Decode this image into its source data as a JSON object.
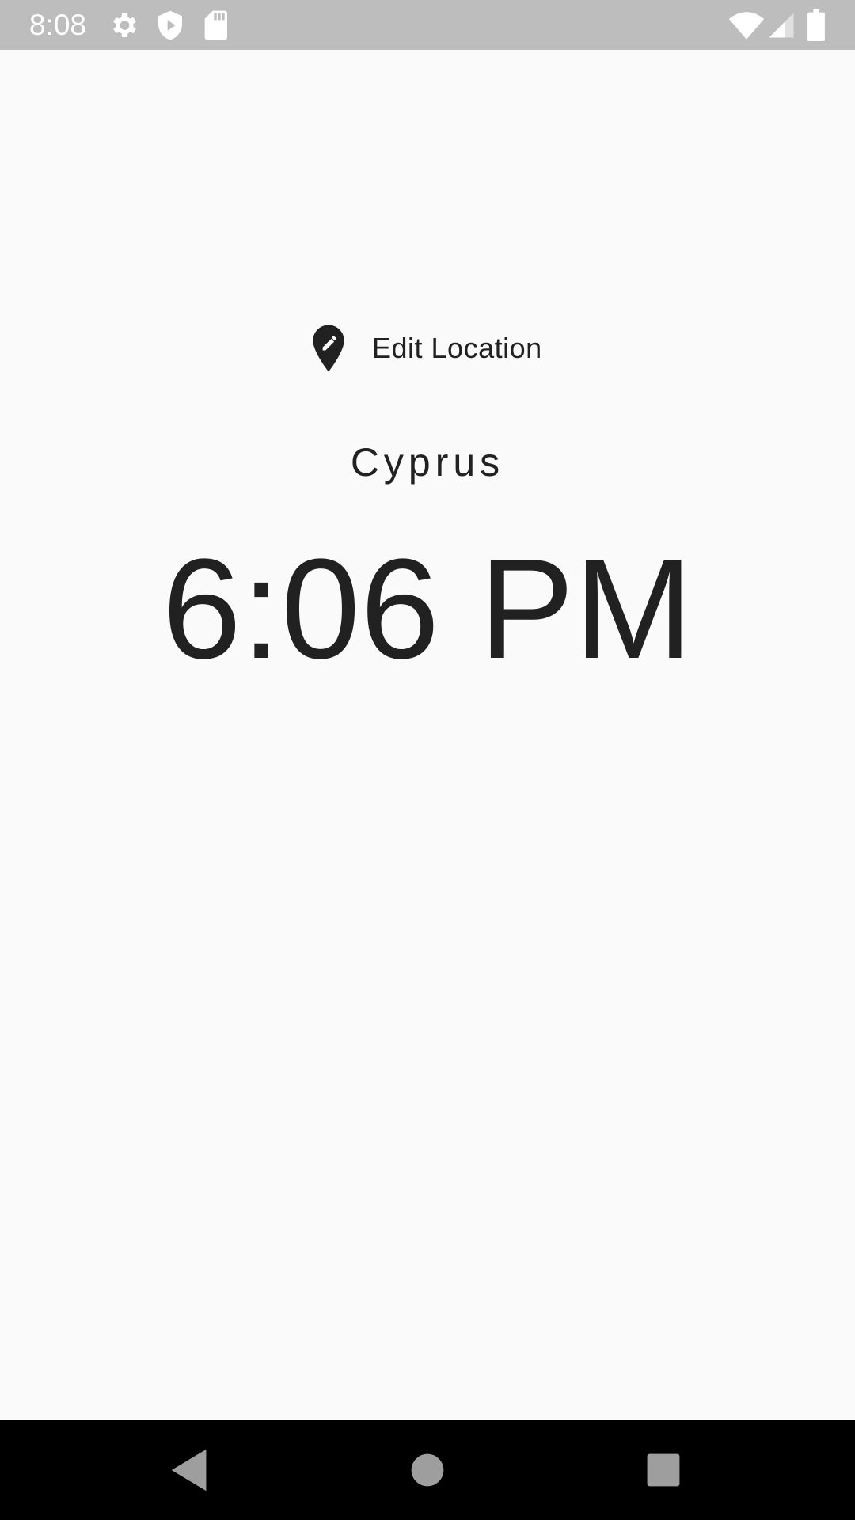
{
  "status_bar": {
    "time": "8:08",
    "icons": [
      "settings-icon",
      "shield-play-icon",
      "sd-card-icon",
      "wifi-icon",
      "signal-icon",
      "battery-icon"
    ],
    "background": "#bdbdbd"
  },
  "main": {
    "edit_location_label": "Edit Location",
    "location": "Cyprus",
    "time": "6:06 PM"
  },
  "nav_bar": {
    "buttons": [
      "back-icon",
      "home-icon",
      "recents-icon"
    ]
  },
  "colors": {
    "background": "#fafafa",
    "text": "#212121",
    "nav": "#000000"
  }
}
